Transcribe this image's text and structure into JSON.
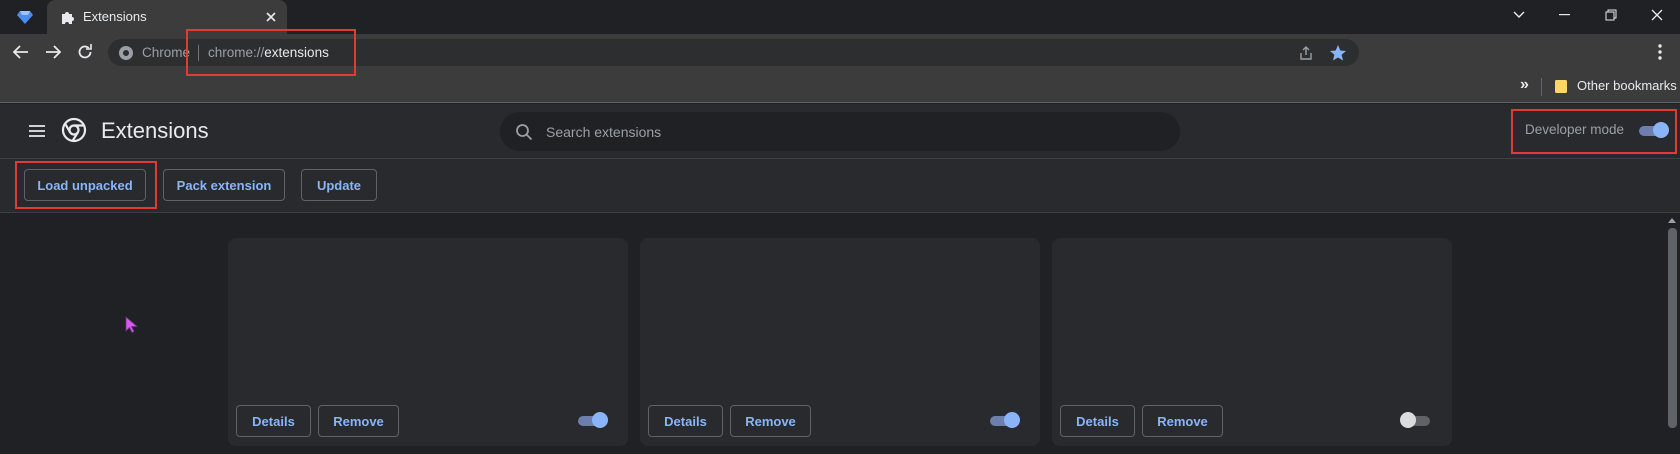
{
  "tab": {
    "title": "Extensions"
  },
  "omnibox": {
    "site_label": "Chrome",
    "url_prefix": "chrome://",
    "url_host": "extensions"
  },
  "bookmarks": {
    "overflow": "»",
    "folder_label": "Other bookmarks"
  },
  "header": {
    "title": "Extensions",
    "search_placeholder": "Search extensions",
    "developer_mode_label": "Developer mode",
    "developer_mode_on": true
  },
  "actions": {
    "load_unpacked": "Load unpacked",
    "pack_extension": "Pack extension",
    "update": "Update"
  },
  "cards": [
    {
      "details": "Details",
      "remove": "Remove",
      "enabled": true
    },
    {
      "details": "Details",
      "remove": "Remove",
      "enabled": true
    },
    {
      "details": "Details",
      "remove": "Remove",
      "enabled": false
    }
  ],
  "colors": {
    "accent": "#8ab4f8",
    "annotation": "#e53935",
    "page_bg": "#202124",
    "surface": "#292a2d",
    "cursor": "#d65cf0"
  },
  "icons": {
    "app": "diamond-icon",
    "tab": "puzzle-icon",
    "close": "close-icon",
    "back": "arrow-left-icon",
    "forward": "arrow-right-icon",
    "reload": "reload-icon",
    "share": "share-icon",
    "star": "star-icon",
    "menu": "kebab-menu-icon",
    "folder": "folder-icon",
    "hamburger": "hamburger-icon",
    "logo": "chrome-logo-icon",
    "search": "search-icon"
  }
}
